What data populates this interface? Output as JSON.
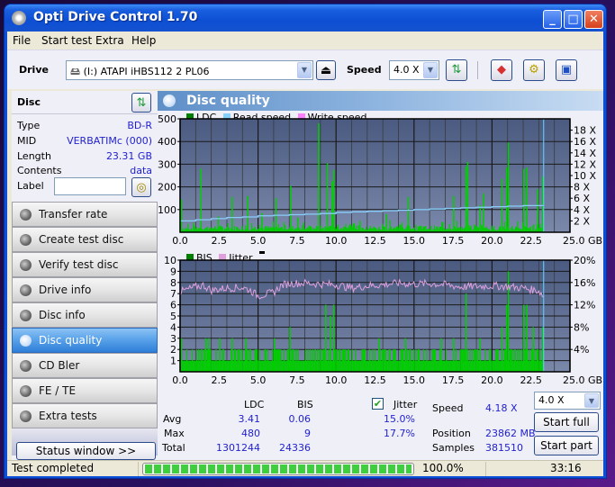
{
  "window": {
    "title": "Opti Drive Control 1.70",
    "controls": [
      "minimize",
      "maximize",
      "close"
    ]
  },
  "menu": [
    "File",
    "Start test",
    "Extra",
    "Help"
  ],
  "toolbar": {
    "drive_label": "Drive",
    "drive_value": "(I:)  ATAPI iHBS112  2 PL06",
    "speed_label": "Speed",
    "speed_value": "4.0 X",
    "icons": [
      "refresh-icon",
      "eraser-icon",
      "settings-icon",
      "save-icon"
    ]
  },
  "disc": {
    "title": "Disc",
    "rows": [
      {
        "key": "Type",
        "value": "BD-R"
      },
      {
        "key": "MID",
        "value": "VERBATIMc (000)"
      },
      {
        "key": "Length",
        "value": "23.31 GB"
      },
      {
        "key": "Contents",
        "value": "data"
      }
    ],
    "label_key": "Label",
    "label_value": ""
  },
  "nav": [
    {
      "label": "Transfer rate",
      "active": false
    },
    {
      "label": "Create test disc",
      "active": false
    },
    {
      "label": "Verify test disc",
      "active": false
    },
    {
      "label": "Drive info",
      "active": false
    },
    {
      "label": "Disc info",
      "active": false
    },
    {
      "label": "Disc quality",
      "active": true
    },
    {
      "label": "CD Bler",
      "active": false
    },
    {
      "label": "FE / TE",
      "active": false
    },
    {
      "label": "Extra tests",
      "active": false
    }
  ],
  "status_window_label": "Status window >>",
  "panel": {
    "title": "Disc quality"
  },
  "chart_data": [
    {
      "type": "bar",
      "title": "LDC",
      "legend": [
        {
          "name": "LDC",
          "color": "#008000"
        },
        {
          "name": "Read speed",
          "color": "#87cefa"
        },
        {
          "name": "Write speed",
          "color": "#ff80ff"
        }
      ],
      "x_ticks": [
        "0.0",
        "2.5",
        "5.0",
        "7.5",
        "10.0",
        "12.5",
        "15.0",
        "17.5",
        "20.0",
        "22.5",
        "25.0 GB"
      ],
      "xlim": [
        0,
        25
      ],
      "y_left_ticks": [
        "100",
        "200",
        "300",
        "400",
        "500"
      ],
      "ylim_left": [
        0,
        500
      ],
      "y_right_ticks": [
        "2 X",
        "4 X",
        "6 X",
        "8 X",
        "10 X",
        "12 X",
        "14 X",
        "16 X",
        "18 X"
      ],
      "ylim_right": [
        0,
        20
      ],
      "end_position_gb": 23.31,
      "spikes": [
        {
          "x": 0.05,
          "y": 145
        },
        {
          "x": 1.3,
          "y": 280
        },
        {
          "x": 2.4,
          "y": 70
        },
        {
          "x": 3.3,
          "y": 155
        },
        {
          "x": 4.3,
          "y": 160
        },
        {
          "x": 5.2,
          "y": 85
        },
        {
          "x": 6.1,
          "y": 150
        },
        {
          "x": 7.05,
          "y": 205
        },
        {
          "x": 7.5,
          "y": 65
        },
        {
          "x": 8.85,
          "y": 480
        },
        {
          "x": 9.4,
          "y": 305
        },
        {
          "x": 9.7,
          "y": 225
        },
        {
          "x": 9.8,
          "y": 275
        },
        {
          "x": 11.5,
          "y": 50
        },
        {
          "x": 13.2,
          "y": 80
        },
        {
          "x": 14.6,
          "y": 155
        },
        {
          "x": 17.5,
          "y": 160
        },
        {
          "x": 18.3,
          "y": 290
        },
        {
          "x": 18.4,
          "y": 310
        },
        {
          "x": 19.2,
          "y": 120
        },
        {
          "x": 19.4,
          "y": 170
        },
        {
          "x": 20.6,
          "y": 235
        },
        {
          "x": 20.9,
          "y": 285
        },
        {
          "x": 21.0,
          "y": 395
        },
        {
          "x": 22.0,
          "y": 280
        },
        {
          "x": 22.2,
          "y": 285
        },
        {
          "x": 22.9,
          "y": 190
        },
        {
          "x": 23.2,
          "y": 245
        }
      ],
      "read_speed_x": [
        0,
        1,
        2,
        3,
        4,
        5,
        6,
        7,
        8,
        9,
        10,
        11,
        12,
        13,
        14,
        15,
        16,
        17,
        18,
        19,
        20,
        21,
        22,
        23.31
      ],
      "read_speed_y": [
        2.0,
        2.2,
        2.4,
        2.6,
        2.7,
        2.9,
        3.0,
        3.1,
        3.2,
        3.3,
        3.5,
        3.6,
        3.7,
        3.8,
        3.9,
        4.0,
        4.1,
        4.2,
        4.3,
        4.4,
        4.5,
        4.6,
        4.7,
        4.8
      ]
    },
    {
      "type": "bar",
      "title": "BIS",
      "legend": [
        {
          "name": "BIS",
          "color": "#008000"
        },
        {
          "name": "Jitter",
          "color": "#dda0dd"
        }
      ],
      "x_ticks": [
        "0.0",
        "2.5",
        "5.0",
        "7.5",
        "10.0",
        "12.5",
        "15.0",
        "17.5",
        "20.0",
        "22.5",
        "25.0 GB"
      ],
      "xlim": [
        0,
        25
      ],
      "y_left_ticks": [
        "1",
        "2",
        "3",
        "4",
        "5",
        "6",
        "7",
        "8",
        "9",
        "10"
      ],
      "ylim_left": [
        0,
        10
      ],
      "y_right_ticks": [
        "4%",
        "8%",
        "12%",
        "16%",
        "20%"
      ],
      "ylim_right": [
        0,
        20
      ],
      "end_position_gb": 23.31,
      "spikes": [
        {
          "x": 0.05,
          "y": 3
        },
        {
          "x": 1.6,
          "y": 3
        },
        {
          "x": 1.8,
          "y": 3
        },
        {
          "x": 2.5,
          "y": 3
        },
        {
          "x": 3.3,
          "y": 3
        },
        {
          "x": 4.2,
          "y": 3
        },
        {
          "x": 6.0,
          "y": 3
        },
        {
          "x": 7.0,
          "y": 4
        },
        {
          "x": 9.3,
          "y": 6
        },
        {
          "x": 9.6,
          "y": 5
        },
        {
          "x": 9.8,
          "y": 6
        },
        {
          "x": 12.7,
          "y": 3
        },
        {
          "x": 14.4,
          "y": 3
        },
        {
          "x": 16.7,
          "y": 3
        },
        {
          "x": 17.5,
          "y": 3
        },
        {
          "x": 18.3,
          "y": 7
        },
        {
          "x": 19.2,
          "y": 3
        },
        {
          "x": 20.6,
          "y": 4
        },
        {
          "x": 20.9,
          "y": 6
        },
        {
          "x": 21.0,
          "y": 9
        },
        {
          "x": 22.0,
          "y": 6
        },
        {
          "x": 22.2,
          "y": 6
        },
        {
          "x": 22.6,
          "y": 4
        },
        {
          "x": 23.2,
          "y": 4
        }
      ],
      "jitter_x": [
        0,
        1,
        1.5,
        2,
        3,
        4,
        4.5,
        5,
        6,
        6.5,
        7,
        8,
        9,
        10,
        11,
        12,
        13,
        14,
        15,
        16,
        17,
        18,
        19,
        20,
        21,
        22,
        23,
        23.31
      ],
      "jitter_y": [
        14.3,
        15.2,
        15.5,
        14.6,
        15.0,
        15.1,
        14.6,
        13.6,
        14.2,
        15.5,
        15.8,
        15.9,
        15.7,
        15.6,
        15.0,
        15.4,
        15.6,
        15.9,
        15.7,
        15.8,
        15.6,
        15.2,
        15.3,
        15.4,
        15.3,
        15.0,
        14.5,
        13.5
      ]
    }
  ],
  "stats": {
    "col_ldc": "LDC",
    "col_bis": "BIS",
    "jitter_label": "Jitter",
    "jitter_checked": true,
    "rows": [
      {
        "label": "Avg",
        "ldc": "3.41",
        "bis": "0.06",
        "jitter": "15.0%"
      },
      {
        "label": "Max",
        "ldc": "480",
        "bis": "9",
        "jitter": "17.7%"
      },
      {
        "label": "Total",
        "ldc": "1301244",
        "bis": "24336",
        "jitter": ""
      }
    ],
    "speed_label": "Speed",
    "speed_value": "4.18 X",
    "position_label": "Position",
    "position_value": "23862 MB",
    "samples_label": "Samples",
    "samples_value": "381510",
    "speed_select": "4.0 X",
    "start_full": "Start full",
    "start_part": "Start part"
  },
  "statusbar": {
    "text": "Test completed",
    "progress_percent": 100.0,
    "progress_text": "100.0%",
    "elapsed": "33:16"
  }
}
